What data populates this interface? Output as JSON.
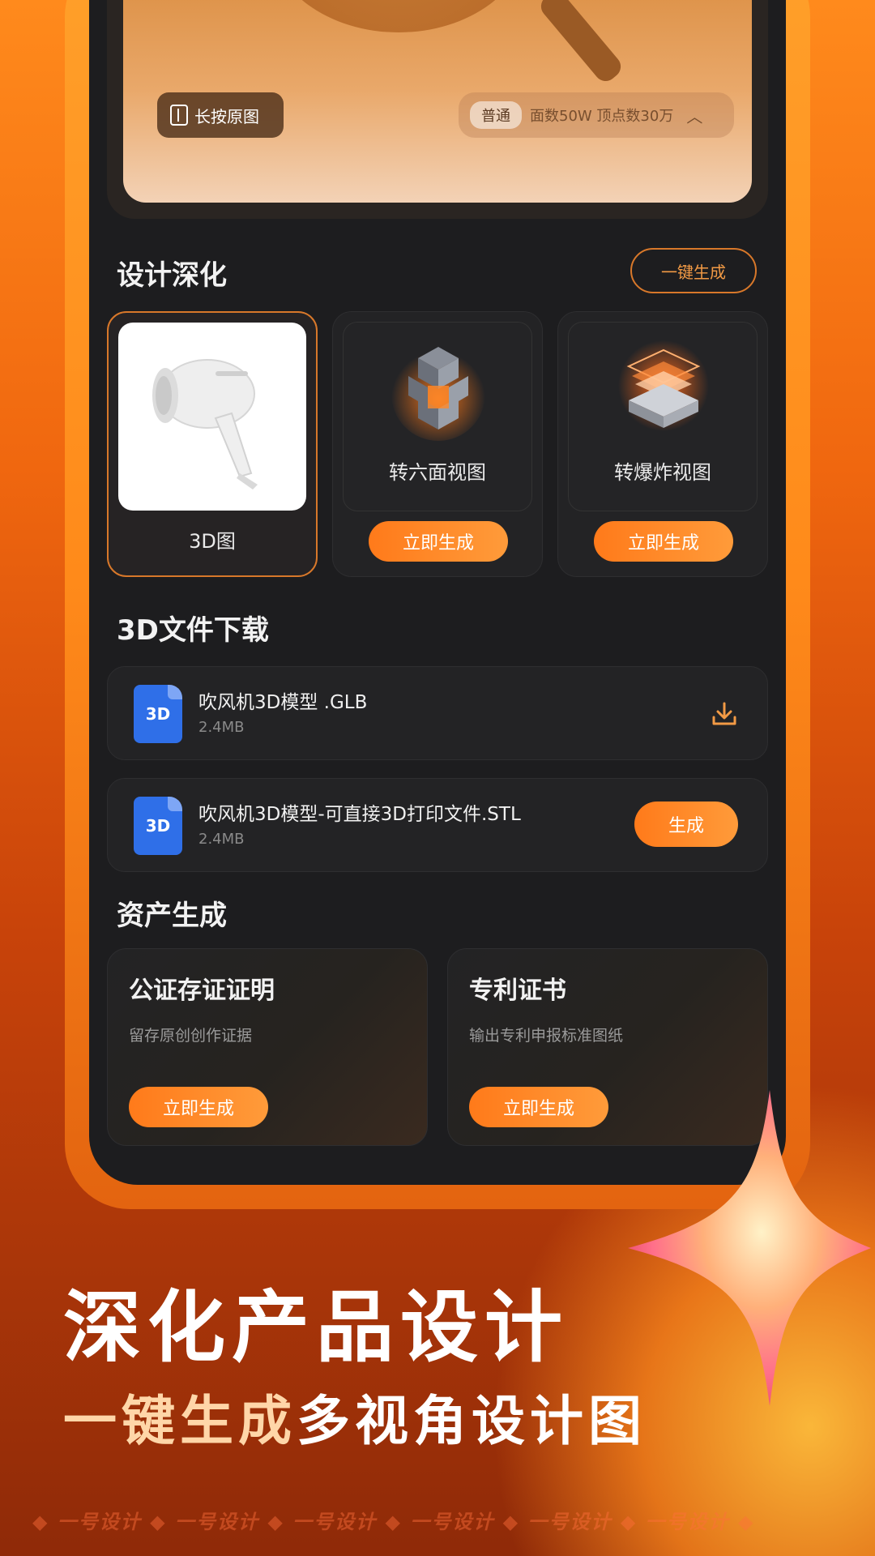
{
  "preview": {
    "press_label": "长按原图",
    "quality_tag": "普通",
    "quality_info": "面数50W 顶点数30万",
    "chevron_icon": "chevron-up-icon"
  },
  "design": {
    "title": "设计深化",
    "onekey_label": "一键生成",
    "cards": [
      {
        "caption": "3D图",
        "icon": "hair-dryer-image"
      },
      {
        "caption": "转六面视图",
        "button": "立即生成",
        "icon": "six-view-cube-icon"
      },
      {
        "caption": "转爆炸视图",
        "button": "立即生成",
        "icon": "exploded-layers-icon"
      }
    ]
  },
  "files": {
    "title": "3D文件下载",
    "items": [
      {
        "badge": "3D",
        "name": "吹风机3D模型 .GLB",
        "size": "2.4MB",
        "action_icon": "download-icon"
      },
      {
        "badge": "3D",
        "name": "吹风机3D模型-可直接3D打印文件.STL",
        "size": "2.4MB",
        "action_label": "生成"
      }
    ]
  },
  "assets": {
    "title": "资产生成",
    "cards": [
      {
        "title": "公证存证证明",
        "desc": "留存原创创作证据",
        "button": "立即生成"
      },
      {
        "title": "专利证书",
        "desc": "输出专利申报标准图纸",
        "button": "立即生成"
      }
    ]
  },
  "promo": {
    "headline": "深化产品设计",
    "sub_highlight": "一键生成",
    "sub_rest": "多视角设计图",
    "footer": "◆ 一号设计 ◆ 一号设计 ◆ 一号设计 ◆ 一号设计 ◆ 一号设计 ◆ 一号设计 ◆"
  },
  "colors": {
    "accent": "#ff8a1c",
    "file_icon": "#2f6fe8",
    "screen_bg": "#1d1d1f"
  }
}
